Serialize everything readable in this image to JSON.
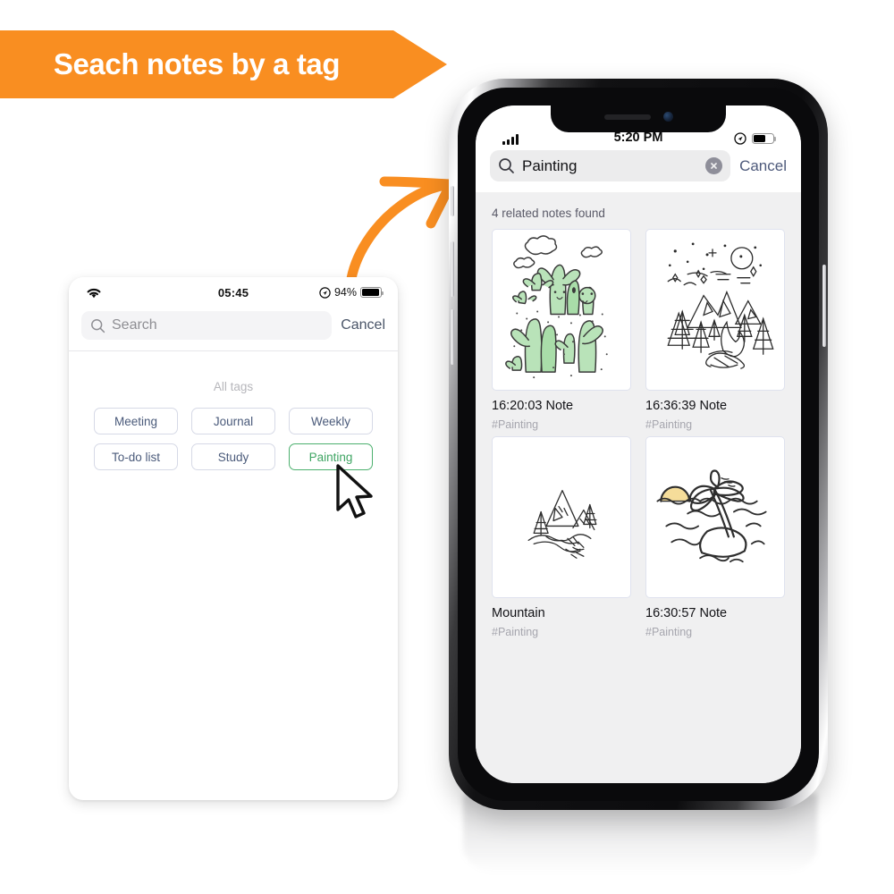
{
  "banner": {
    "text": "Seach notes by a tag",
    "color": "#f98e21"
  },
  "annotation": {
    "arrow_name": "orange-curved-arrow",
    "arrow_color": "#f98e21",
    "cursor_name": "mouse-cursor"
  },
  "left_device": {
    "status_bar": {
      "wifi_icon": "wifi-icon",
      "time": "05:45",
      "location_icon": "location-arrow-icon",
      "battery_percent": "94%",
      "battery_level": 94
    },
    "search": {
      "icon": "search-icon",
      "placeholder": "Search",
      "value": "",
      "cancel_label": "Cancel"
    },
    "tags_section": {
      "header": "All tags",
      "rows": [
        [
          {
            "label": "Meeting",
            "selected": false
          },
          {
            "label": "Journal",
            "selected": false
          },
          {
            "label": "Weekly",
            "selected": false
          }
        ],
        [
          {
            "label": "To-do list",
            "selected": false
          },
          {
            "label": "Study",
            "selected": false
          },
          {
            "label": "Painting",
            "selected": true
          }
        ]
      ],
      "selected_color": "#4cb06e",
      "default_color": "#4a5a7a"
    }
  },
  "phone": {
    "status_bar": {
      "signal_icon": "cellular-signal-icon",
      "time": "5:20 PM",
      "location_icon": "location-arrow-icon",
      "battery_level": 62
    },
    "search": {
      "icon": "search-icon",
      "value": "Painting",
      "placeholder": "Search",
      "clear_icon": "clear-circle-icon",
      "cancel_label": "Cancel"
    },
    "results": {
      "count_text": "4 related notes found",
      "notes": [
        {
          "title": "16:20:03 Note",
          "tag": "#Painting",
          "thumb": "cactus-doodle"
        },
        {
          "title": "16:36:39 Note",
          "tag": "#Painting",
          "thumb": "campfire-mountain-night-doodle"
        },
        {
          "title": "Mountain",
          "tag": "#Painting",
          "thumb": "small-mountain-doodle"
        },
        {
          "title": "16:30:57 Note",
          "tag": "#Painting",
          "thumb": "palm-island-doodle"
        }
      ]
    }
  }
}
